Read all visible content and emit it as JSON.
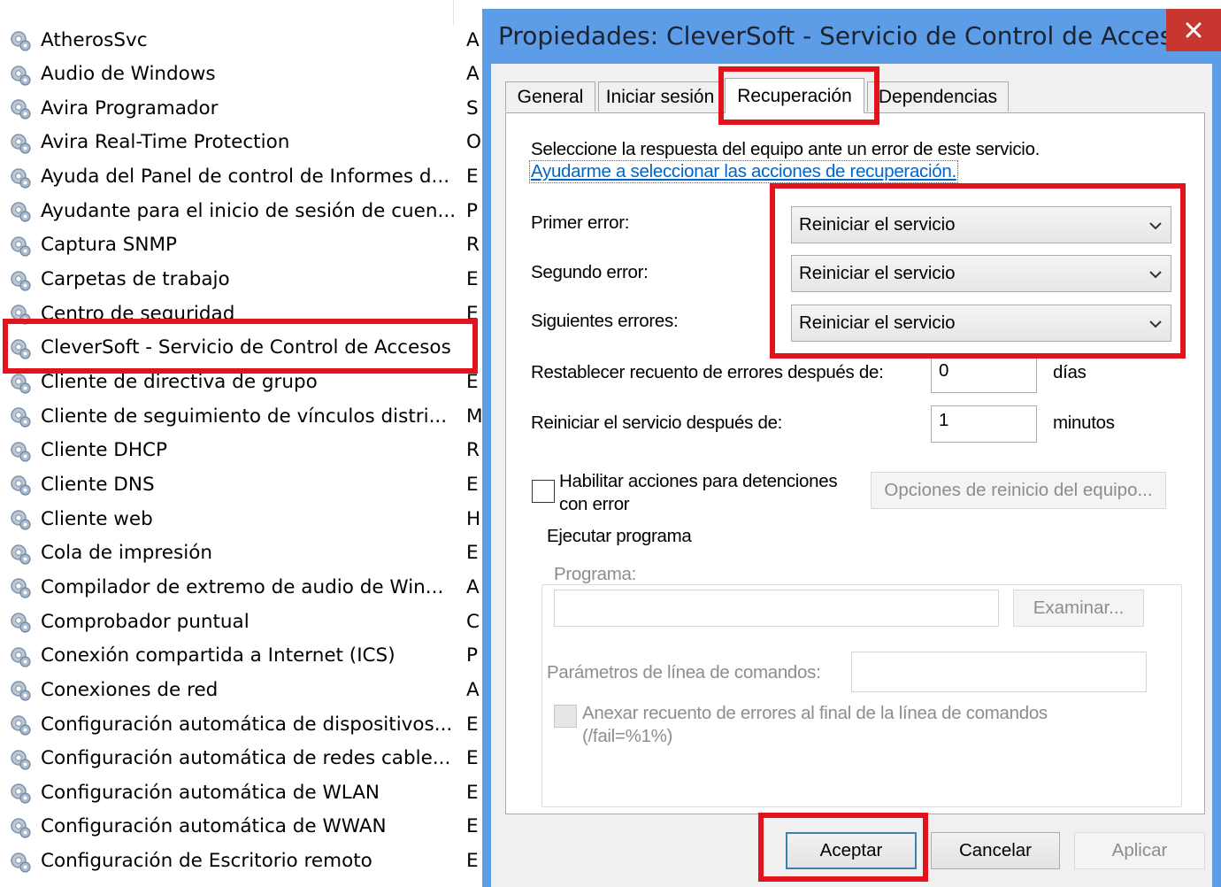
{
  "services": {
    "rows": [
      {
        "name": "AtherosSvc",
        "desc": "A"
      },
      {
        "name": "Audio de Windows",
        "desc": "A"
      },
      {
        "name": "Avira Programador",
        "desc": "S"
      },
      {
        "name": "Avira Real-Time Protection",
        "desc": "O"
      },
      {
        "name": "Ayuda del Panel de control de Informes d...",
        "desc": "E"
      },
      {
        "name": "Ayudante para el inicio de sesión de cuen...",
        "desc": "P"
      },
      {
        "name": "Captura SNMP",
        "desc": "R"
      },
      {
        "name": "Carpetas de trabajo",
        "desc": "E"
      },
      {
        "name": "Centro de seguridad",
        "desc": "E"
      },
      {
        "name": "CleverSoft - Servicio de Control de Accesos",
        "desc": ""
      },
      {
        "name": "Cliente de directiva de grupo",
        "desc": "E"
      },
      {
        "name": "Cliente de seguimiento de vínculos distri...",
        "desc": "M"
      },
      {
        "name": "Cliente DHCP",
        "desc": "R"
      },
      {
        "name": "Cliente DNS",
        "desc": "E"
      },
      {
        "name": "Cliente web",
        "desc": "H"
      },
      {
        "name": "Cola de impresión",
        "desc": "E"
      },
      {
        "name": "Compilador de extremo de audio de Win...",
        "desc": "A"
      },
      {
        "name": "Comprobador puntual",
        "desc": "C"
      },
      {
        "name": "Conexión compartida a Internet (ICS)",
        "desc": "P"
      },
      {
        "name": "Conexiones de red",
        "desc": "A"
      },
      {
        "name": "Configuración automática de dispositivos...",
        "desc": "E"
      },
      {
        "name": "Configuración automática de redes cable...",
        "desc": "E"
      },
      {
        "name": "Configuración automática de WLAN",
        "desc": "E"
      },
      {
        "name": "Configuración automática de WWAN",
        "desc": "E"
      },
      {
        "name": "Configuración de Escritorio remoto",
        "desc": "E"
      }
    ]
  },
  "dialog": {
    "title": "Propiedades: CleverSoft - Servicio de Control de Acces...",
    "close_label": "✕",
    "tabs": [
      {
        "label": "General"
      },
      {
        "label": "Iniciar sesión"
      },
      {
        "label": "Recuperación"
      },
      {
        "label": "Dependencias"
      }
    ],
    "active_tab": "Recuperación",
    "intro": "Seleccione la respuesta del equipo ante un error de este servicio.",
    "help_link": "Ayudarme a seleccionar las acciones de recuperación.",
    "first_failure": {
      "label": "Primer error:",
      "value": "Reiniciar el servicio"
    },
    "second_failure": {
      "label": "Segundo error:",
      "value": "Reiniciar el servicio"
    },
    "subsequent_failures": {
      "label": "Siguientes errores:",
      "value": "Reiniciar el servicio"
    },
    "reset_count": {
      "label": "Restablecer recuento de errores después de:",
      "value": "0",
      "unit": "días"
    },
    "restart_after": {
      "label": "Reiniciar el servicio después de:",
      "value": "1",
      "unit": "minutos"
    },
    "enable_actions": {
      "line1": "Habilitar acciones para detenciones",
      "line2": "con error",
      "checked": false
    },
    "restart_options_button": "Opciones de reinicio del equipo...",
    "run_program": {
      "group_label": "Ejecutar programa",
      "program_label": "Programa:",
      "program_value": "",
      "browse_button": "Examinar...",
      "params_label": "Parámetros de línea de comandos:",
      "params_value": "",
      "append_line1": "Anexar recuento de errores al final de la línea de comandos",
      "append_line2": "(/fail=%1%)"
    },
    "buttons": {
      "ok": "Aceptar",
      "cancel": "Cancelar",
      "apply": "Aplicar"
    }
  },
  "colors": {
    "highlight": "#e3131e",
    "title_bar": "#5d9ce6",
    "close_button": "#c7372f",
    "link": "#0066cc"
  }
}
